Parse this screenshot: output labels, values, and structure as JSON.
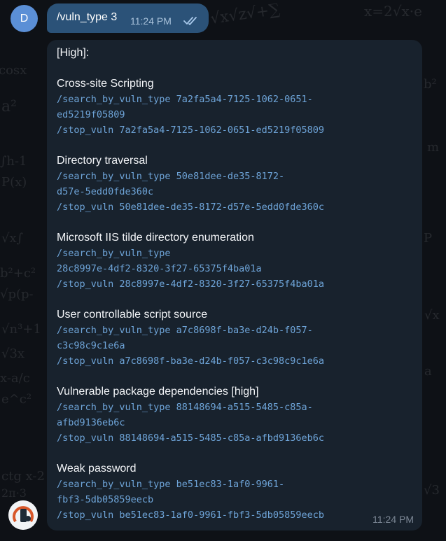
{
  "outgoing": {
    "avatar_letter": "D",
    "text": "/vuln_type 3",
    "time": "11:24 PM",
    "status_icon": "double-check-icon"
  },
  "incoming": {
    "header": "[High]:",
    "time": "11:24 PM",
    "vulns": [
      {
        "title": "Cross-site Scripting",
        "lines": [
          "/search_by_vuln_type 7a2fa5a4-7125-1062-0651-",
          "ed5219f05809",
          "/stop_vuln 7a2fa5a4-7125-1062-0651-ed5219f05809"
        ]
      },
      {
        "title": "Directory traversal",
        "lines": [
          "/search_by_vuln_type 50e81dee-de35-8172-",
          "d57e-5edd0fde360c",
          "/stop_vuln 50e81dee-de35-8172-d57e-5edd0fde360c"
        ]
      },
      {
        "title": "Microsoft IIS tilde directory enumeration",
        "lines": [
          "/search_by_vuln_type",
          "28c8997e-4df2-8320-3f27-65375f4ba01a",
          "/stop_vuln 28c8997e-4df2-8320-3f27-65375f4ba01a"
        ]
      },
      {
        "title": "User controllable script source",
        "lines": [
          "/search_by_vuln_type a7c8698f-ba3e-d24b-f057-",
          "c3c98c9c1e6a",
          "/stop_vuln a7c8698f-ba3e-d24b-f057-c3c98c9c1e6a"
        ]
      },
      {
        "title": "Vulnerable package dependencies [high]",
        "lines": [
          "/search_by_vuln_type 88148694-a515-5485-c85a-",
          "afbd9136eb6c",
          "/stop_vuln 88148694-a515-5485-c85a-afbd9136eb6c"
        ]
      },
      {
        "title": "Weak password",
        "lines": [
          "/search_by_vuln_type be51ec83-1af0-9961-",
          "fbf3-5db05859eecb",
          "/stop_vuln be51ec83-1af0-9961-fbf3-5db05859eecb"
        ]
      }
    ]
  },
  "colors": {
    "outgoing_bubble": "#2b5278",
    "incoming_bubble": "#18222d",
    "command_link": "#6ea4d8",
    "background": "#0e1116"
  }
}
